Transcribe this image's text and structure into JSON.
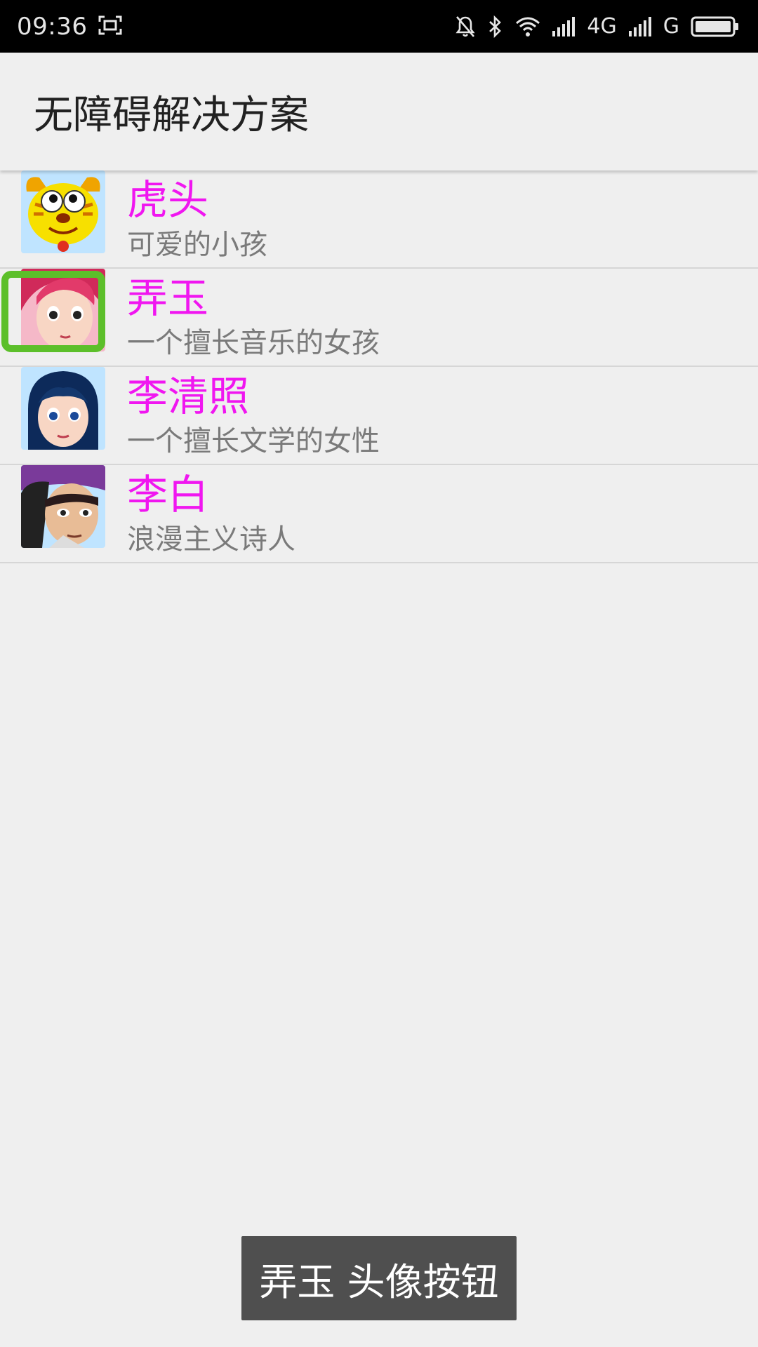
{
  "status_bar": {
    "time": "09:36",
    "network_1": "4G",
    "network_2": "G",
    "icons": [
      "screenshot-icon",
      "bell-off-icon",
      "bluetooth-icon",
      "wifi-icon",
      "signal-icon",
      "battery-icon"
    ]
  },
  "app_bar": {
    "title": "无障碍解决方案"
  },
  "list": {
    "items": [
      {
        "name": "虎头",
        "description": "可爱的小孩",
        "avatar": "tiger-avatar"
      },
      {
        "name": "弄玉",
        "description": "一个擅长音乐的女孩",
        "avatar": "nongyu-avatar"
      },
      {
        "name": "李清照",
        "description": "一个擅长文学的女性",
        "avatar": "liqingzhao-avatar"
      },
      {
        "name": "李白",
        "description": "浪漫主义诗人",
        "avatar": "libai-avatar"
      }
    ]
  },
  "toast": {
    "text": "弄玉 头像按钮"
  },
  "colors": {
    "name_accent": "#f016f0",
    "focus_ring": "#5cbf2a",
    "background": "#efefef",
    "toast_bg": "#4f4f4f"
  }
}
